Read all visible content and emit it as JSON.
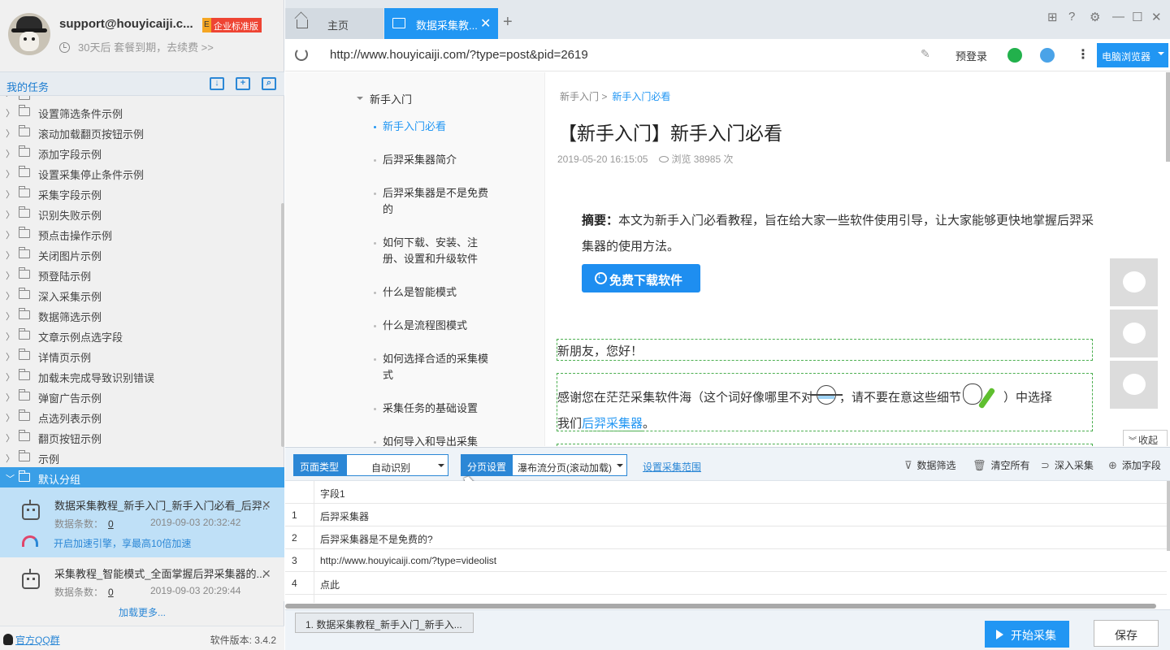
{
  "profile": {
    "email": "support@houyicaiji.c...",
    "edition_badge_letter": "E",
    "edition_badge": "企业标准版",
    "expire_text": "30天后 套餐到期，去续费 >>"
  },
  "tasks_panel": {
    "title": "我的任务",
    "tree_items": [
      {
        "label": "设置筛选条件示例"
      },
      {
        "label": "滚动加载翻页按钮示例"
      },
      {
        "label": "添加字段示例"
      },
      {
        "label": "设置采集停止条件示例"
      },
      {
        "label": "采集字段示例"
      },
      {
        "label": "识别失败示例"
      },
      {
        "label": "预点击操作示例"
      },
      {
        "label": "关闭图片示例"
      },
      {
        "label": "预登陆示例"
      },
      {
        "label": "深入采集示例"
      },
      {
        "label": "数据筛选示例"
      },
      {
        "label": "文章示例点选字段"
      },
      {
        "label": "详情页示例"
      },
      {
        "label": "加载未完成导致识别错误"
      },
      {
        "label": "弹窗广告示例"
      },
      {
        "label": "点选列表示例"
      },
      {
        "label": "翻页按钮示例"
      },
      {
        "label": "示例"
      }
    ],
    "active_group": "默认分组",
    "tasks": [
      {
        "name": "数据采集教程_新手入门_新手入门必看_后羿..",
        "count_label": "数据条数：",
        "count": "0",
        "date": "2019-09-03 20:32:42"
      },
      {
        "name": "采集教程_智能模式_全面掌握后羿采集器的...",
        "count_label": "数据条数：",
        "count": "0",
        "date": "2019-09-03 20:29:44"
      }
    ],
    "accel_text": "开启加速引擎，享最高10倍加速",
    "load_more": "加载更多...",
    "qq_group": "官方QQ群",
    "version": "软件版本: 3.4.2"
  },
  "browser": {
    "tabs": [
      {
        "label": "主页"
      },
      {
        "label": "数据采集教..."
      }
    ],
    "new_tab": "+",
    "url": "http://www.houyicaiji.com/?type=post&pid=2619",
    "prelogin": "预登录",
    "browser_mode": "电脑浏览器"
  },
  "page": {
    "nav_root": "新手入门",
    "nav_items": [
      {
        "label": "新手入门必看"
      },
      {
        "label": "后羿采集器简介"
      },
      {
        "label": "后羿采集器是不是免费的"
      },
      {
        "label": "如何下载、安装、注册、设置和升级软件"
      },
      {
        "label": "什么是智能模式"
      },
      {
        "label": "什么是流程图模式"
      },
      {
        "label": "如何选择合适的采集模式"
      },
      {
        "label": "采集任务的基础设置"
      },
      {
        "label": "如何导入和导出采集"
      }
    ],
    "breadcrumb_parent": "新手入门 >",
    "breadcrumb_current": "新手入门必看",
    "title": "【新手入门】新手入门必看",
    "date": "2019-05-20 16:15:05",
    "views": "浏览 38985 次",
    "summary_label": "摘要：",
    "summary_text": "本文为新手入门必看教程，旨在给大家一些软件使用引导，让大家能够更快地掌握后羿采集器的使用方法。",
    "download_button": "免费下载软件",
    "para1": "新朋友，您好！",
    "para2_a": "感谢您在茫茫采集软件海（这个词好像哪里不对",
    "para2_b": "，请不要在意这些细节",
    "para2_c": "）中选择",
    "para2_d": "我们",
    "para2_link": "后羿采集器",
    "para2_e": "。",
    "collapse": "收起"
  },
  "config": {
    "page_type_label": "页面类型",
    "page_type_value": "自动识别",
    "paging_label": "分页设置",
    "paging_value": "瀑布流分页(滚动加载)",
    "range_link": "设置采集范围",
    "actions": [
      {
        "icon": "filter-icon",
        "label": "数据筛选"
      },
      {
        "icon": "trash-icon",
        "label": "清空所有"
      },
      {
        "icon": "link-icon",
        "label": "深入采集"
      },
      {
        "icon": "plus-circle-icon",
        "label": "添加字段"
      }
    ]
  },
  "table": {
    "header": "字段1",
    "rows": [
      {
        "idx": "1",
        "value": "后羿采集器"
      },
      {
        "idx": "2",
        "value": "后羿采集器是不是免费的?"
      },
      {
        "idx": "3",
        "value": "http://www.houyicaiji.com/?type=videolist"
      },
      {
        "idx": "4",
        "value": "点此"
      }
    ]
  },
  "bottom": {
    "task_tab": "1. 数据采集教程_新手入门_新手入...",
    "start": "开始采集",
    "save": "保存"
  }
}
